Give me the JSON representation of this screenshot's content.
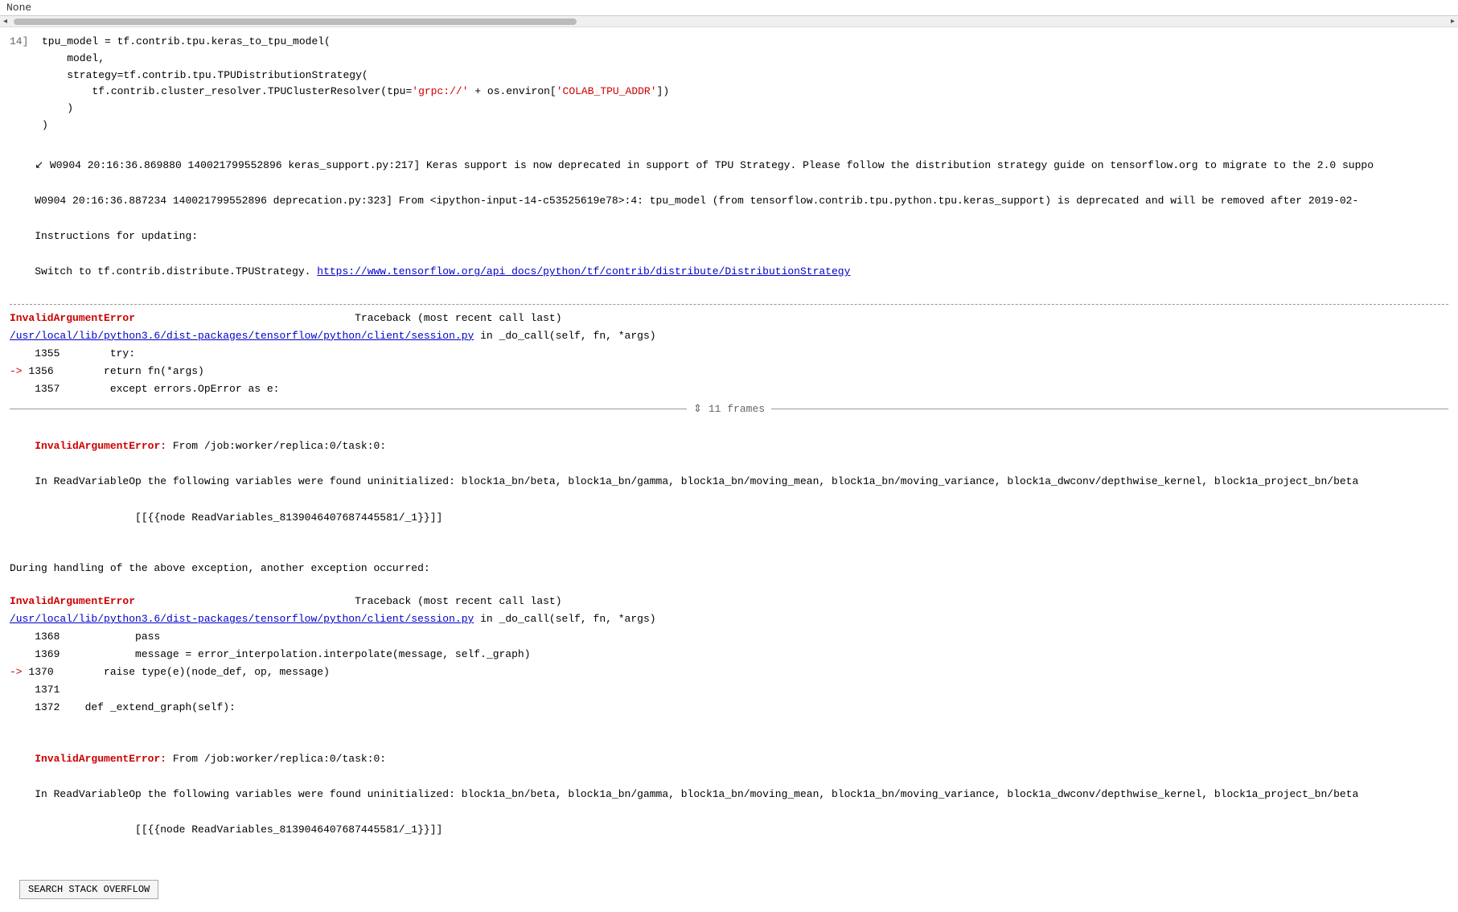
{
  "topbar": {
    "text": "None"
  },
  "scrollbar": {
    "left_arrow": "◂",
    "right_arrow": "▸"
  },
  "code_block": {
    "line_num": "14]",
    "lines": [
      {
        "num": "",
        "text": "tpu_model = tf.contrib.tpu.keras_to_tpu_model("
      },
      {
        "num": "",
        "text": "    model,"
      },
      {
        "num": "",
        "text": "    strategy=tf.contrib.tpu.TPUDistributionStrategy("
      },
      {
        "num": "",
        "text": "        tf.contrib.cluster_resolver.TPUClusterResolver(tpu=",
        "string1": "'grpc://'",
        "mid": " + os.environ[",
        "string2": "'COLAB_TPU_ADDR'",
        "end": "])"
      },
      {
        "num": "",
        "text": "    )"
      },
      {
        "num": "",
        "text": ")"
      }
    ]
  },
  "warnings": [
    "W0904 20:16:36.869880 140021799552896 keras_support.py:217] Keras support is now deprecated in support of TPU Strategy. Please follow the distribution strategy guide on tensorflow.org to migrate to the 2.0 suppo",
    "W0904 20:16:36.887234 140021799552896 deprecation.py:323] From <ipython-input-14-c53525619e78>:4: tpu_model (from tensorflow.contrib.tpu.python.tpu.keras_support) is deprecated and will be removed after 2019-02-",
    "Instructions for updating:",
    "Switch to tf.contrib.distribute.TPUStrategy. "
  ],
  "switch_link": "https://www.tensorflow.org/api_docs/python/tf/contrib/distribute/DistributionStrategy",
  "traceback1": {
    "error_type": "InvalidArgumentError",
    "traceback_label": "Traceback (most recent call last)",
    "file_path": "/usr/local/lib/python3.6/dist-packages/tensorflow/python/client/session.py",
    "file_suffix": " in _do_call(self, fn, *args)",
    "lines": [
      {
        "num": "1355",
        "text": "    try:"
      },
      {
        "num": "1356",
        "text": "        return fn(*args)",
        "arrow": true
      },
      {
        "num": "1357",
        "text": "    except errors.OpError as e:"
      }
    ]
  },
  "frames_bar": {
    "left_dash": "——————————————————————",
    "icon": "⇕",
    "count": "11 frames",
    "right_dash": "——————————————————————————————————————————————————————————————————————————————————————————————————————————————————————————————————"
  },
  "error1": {
    "title": "InvalidArgumentError:",
    "message": "From /job:worker/replica:0/task:0:",
    "detail": "In ReadVariableOp the following variables were found uninitialized: block1a_bn/beta, block1a_bn/gamma, block1a_bn/moving_mean, block1a_bn/moving_variance, block1a_dwconv/depthwise_kernel, block1a_project_bn/beta",
    "detail2": "        [[{node ReadVariables_8139046407687445581/_1}}]]"
  },
  "between_text": "During handling of the above exception, another exception occurred:",
  "traceback2": {
    "error_type": "InvalidArgumentError",
    "traceback_label": "Traceback (most recent call last)",
    "file_path": "/usr/local/lib/python3.6/dist-packages/tensorflow/python/client/session.py",
    "file_suffix": " in _do_call(self, fn, *args)",
    "lines": [
      {
        "num": "1368",
        "text": "            pass"
      },
      {
        "num": "1369",
        "text": "            message = error_interpolation.interpolate(message, self._graph)"
      },
      {
        "num": "1370",
        "text": "        raise type(e)(node_def, op, message)",
        "arrow": true
      },
      {
        "num": "1371",
        "text": ""
      },
      {
        "num": "1372",
        "text": "    def _extend_graph(self):"
      }
    ]
  },
  "error2": {
    "title": "InvalidArgumentError:",
    "message": "From /job:worker/replica:0/task:0:",
    "detail": "In ReadVariableOp the following variables were found uninitialized: block1a_bn/beta, block1a_bn/gamma, block1a_bn/moving_mean, block1a_bn/moving_variance, block1a_dwconv/depthwise_kernel, block1a_project_bn/beta",
    "detail2": "        [[{node ReadVariables_8139046407687445581/_1}}]]"
  },
  "search_button": {
    "label": "SEARCH STACK OVERFLOW"
  }
}
